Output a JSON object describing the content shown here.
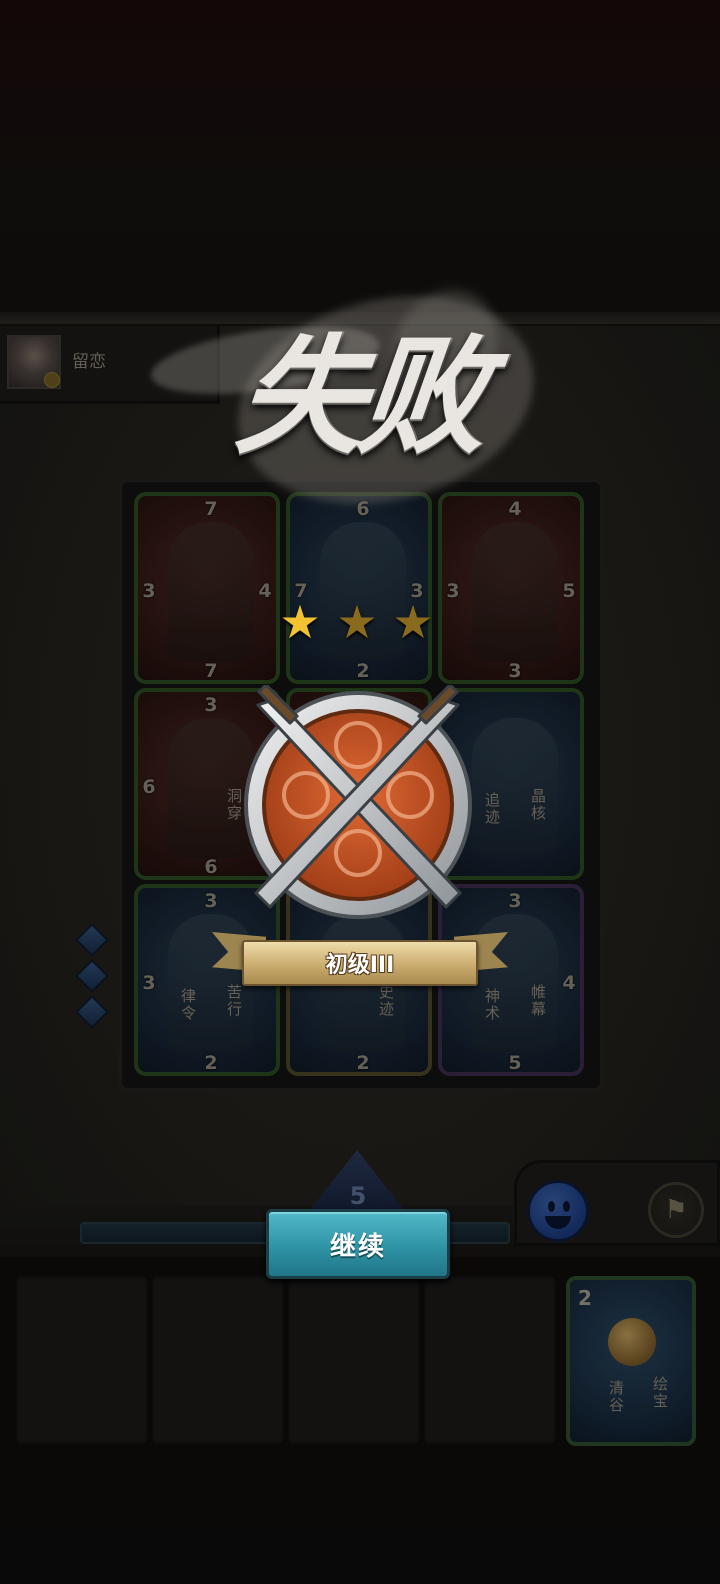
{
  "opponent": {
    "name": "留恋"
  },
  "result": {
    "title": "失败",
    "rank": "初级III",
    "stars_earned": 1,
    "stars_total": 3
  },
  "board": {
    "cards": [
      {
        "col": 0,
        "row": 0,
        "color": "red",
        "frame": "green",
        "labels": [],
        "stats": {
          "top": "7",
          "left": "3",
          "right": "4",
          "bottom": "7"
        }
      },
      {
        "col": 1,
        "row": 0,
        "color": "blue",
        "frame": "green",
        "labels": [],
        "stats": {
          "top": "6",
          "left": "7",
          "right": "3",
          "bottom": "2"
        }
      },
      {
        "col": 2,
        "row": 0,
        "color": "red",
        "frame": "green",
        "labels": [],
        "stats": {
          "top": "4",
          "left": "3",
          "right": "5",
          "bottom": "3"
        }
      },
      {
        "col": 0,
        "row": 1,
        "color": "red",
        "frame": "green",
        "labels": [
          "洞穿"
        ],
        "stats": {
          "top": "3",
          "left": "6",
          "right": "",
          "bottom": "6"
        }
      },
      {
        "col": 1,
        "row": 1,
        "color": "red",
        "frame": "green",
        "labels": [],
        "stats": {
          "top": "",
          "left": "",
          "right": "",
          "bottom": ""
        }
      },
      {
        "col": 2,
        "row": 1,
        "color": "blue",
        "frame": "green",
        "labels": [
          "晶核",
          "追迹"
        ],
        "stats": {
          "top": "",
          "left": "",
          "right": "",
          "bottom": ""
        }
      },
      {
        "col": 0,
        "row": 2,
        "color": "blue",
        "frame": "green",
        "labels": [
          "苦行",
          "律令"
        ],
        "stats": {
          "top": "3",
          "left": "3",
          "right": "",
          "bottom": "2"
        }
      },
      {
        "col": 1,
        "row": 2,
        "color": "blue",
        "frame": "gold",
        "labels": [
          "史迹"
        ],
        "stats": {
          "top": "",
          "left": "",
          "right": "",
          "bottom": "2"
        }
      },
      {
        "col": 2,
        "row": 2,
        "color": "blue",
        "frame": "purple",
        "labels": [
          "帷幕",
          "神术"
        ],
        "stats": {
          "top": "3",
          "left": "",
          "right": "4",
          "bottom": "5"
        }
      }
    ]
  },
  "continue_button": {
    "label": "继续"
  },
  "mana": {
    "value": "5"
  },
  "hand": {
    "card": {
      "cost": "2",
      "labels": [
        "绘宝",
        "清谷"
      ]
    }
  },
  "icons": {
    "emote": "smiley-face-icon",
    "surrender": "white-flag-icon",
    "emblem": "crossed-swords-shield-icon",
    "star": "star-icon"
  },
  "colors": {
    "accent": "#2f93a6",
    "star_on": "#f3c231",
    "star_off": "#8a6b1e"
  }
}
